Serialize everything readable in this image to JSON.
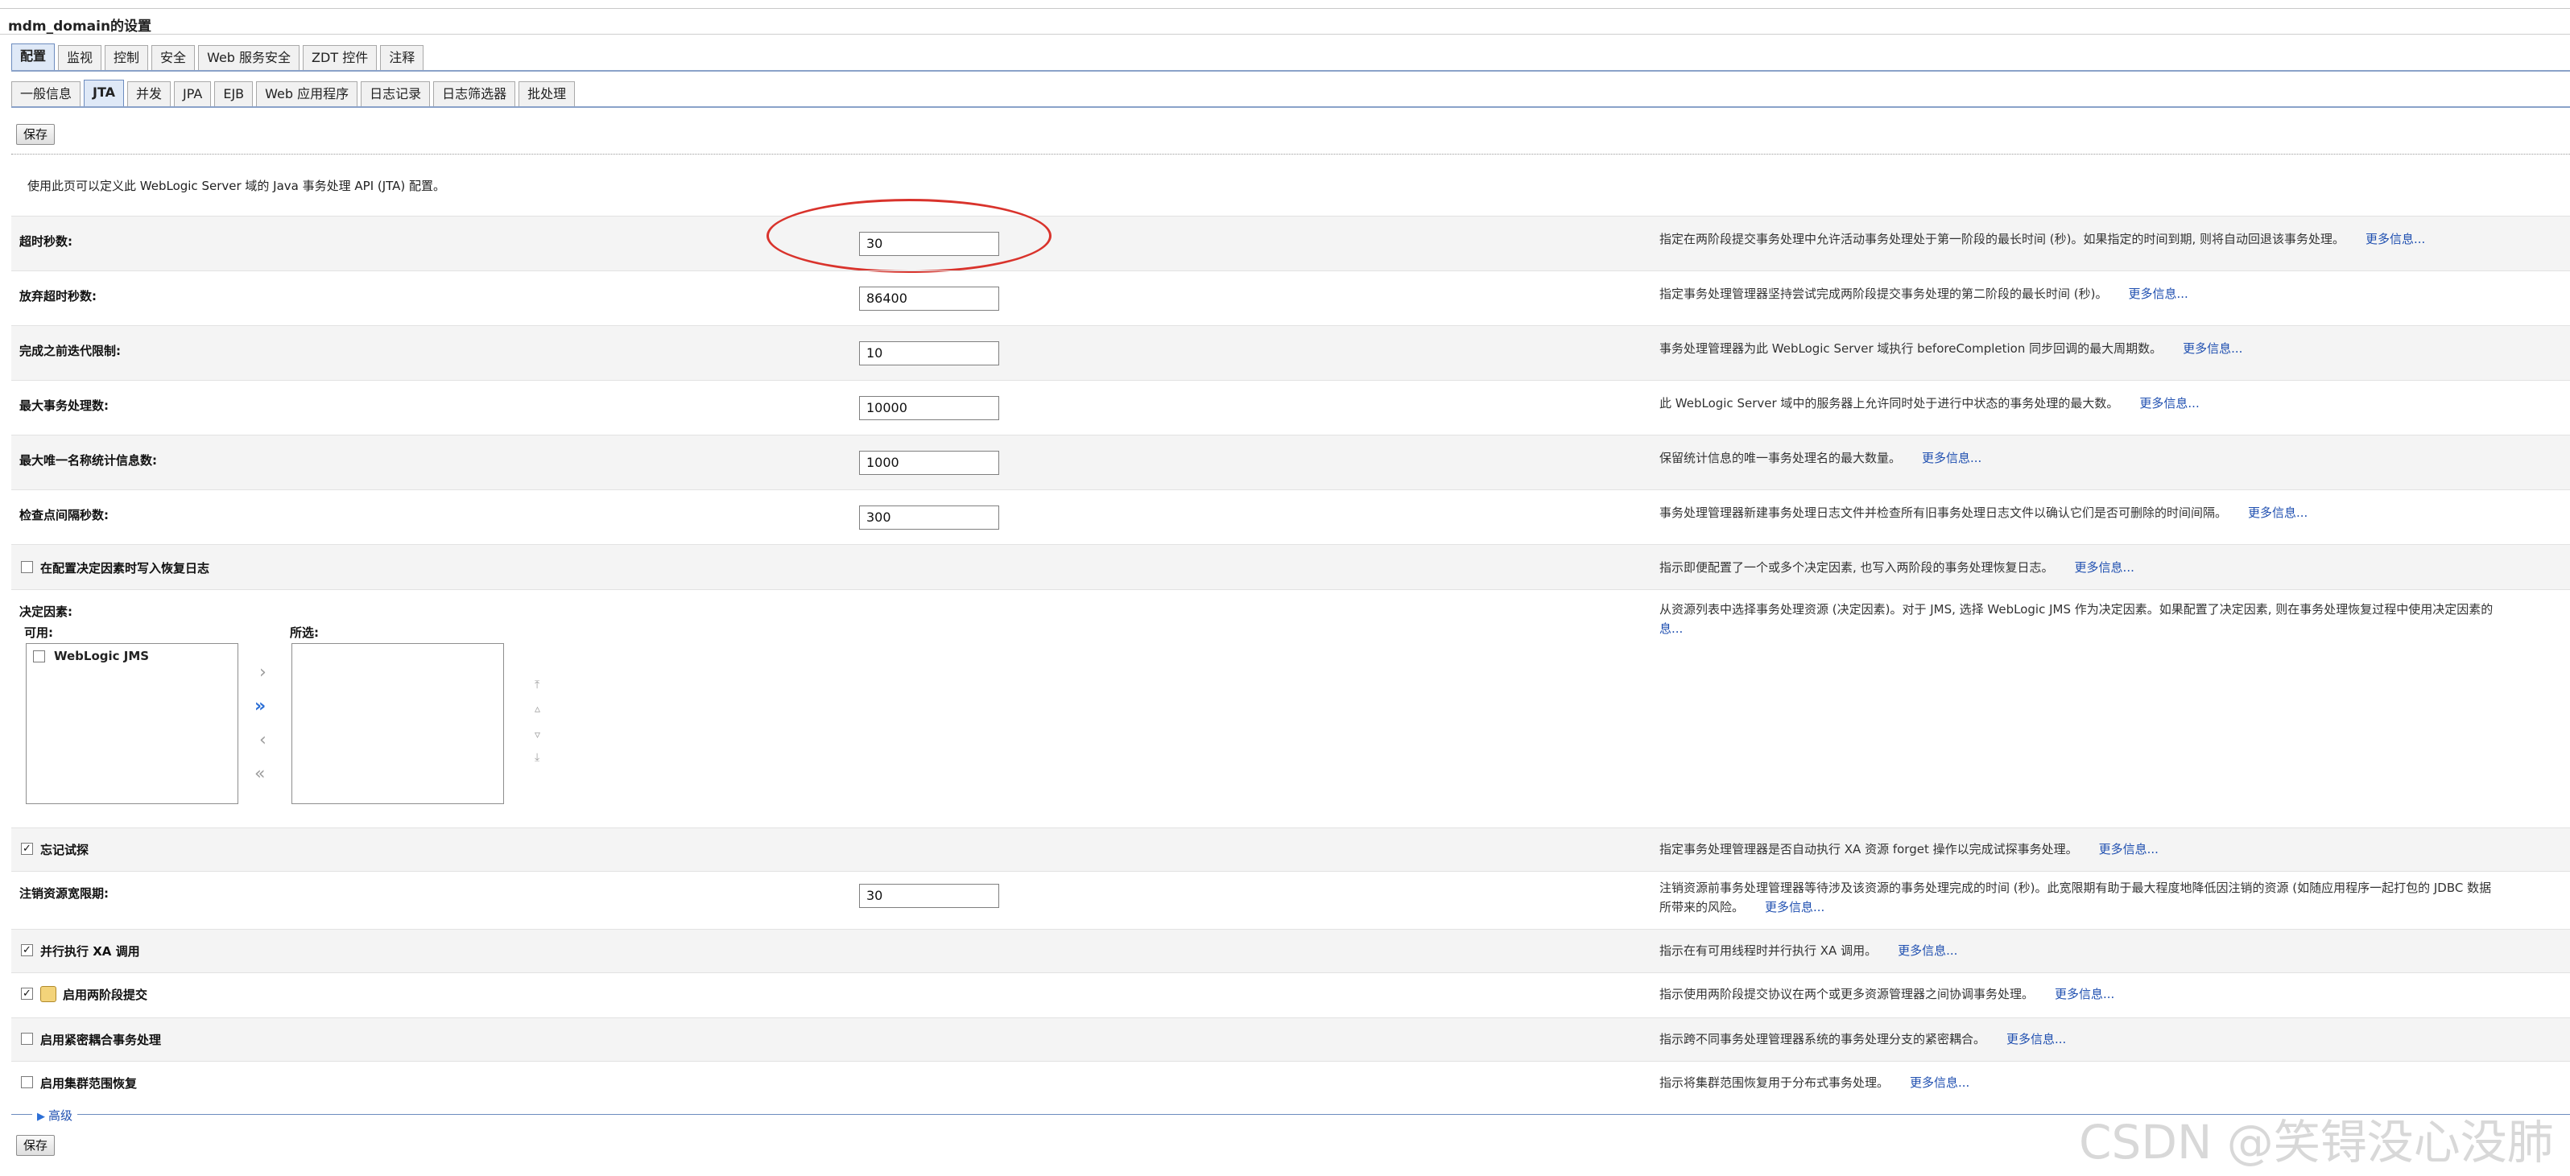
{
  "page_title": "mdm_domain的设置",
  "primary_tabs": [
    "配置",
    "监视",
    "控制",
    "安全",
    "Web 服务安全",
    "ZDT 控件",
    "注释"
  ],
  "secondary_tabs": [
    "一般信息",
    "JTA",
    "并发",
    "JPA",
    "EJB",
    "Web 应用程序",
    "日志记录",
    "日志筛选器",
    "批处理"
  ],
  "save_label": "保存",
  "intro": "使用此页可以定义此 WebLogic Server 域的 Java 事务处理 API (JTA) 配置。",
  "more_label": "更多信息...",
  "fields": {
    "timeout": {
      "label": "超时秒数:",
      "value": "30",
      "desc": "指定在两阶段提交事务处理中允许活动事务处理处于第一阶段的最长时间 (秒)。如果指定的时间到期, 则将自动回退该事务处理。"
    },
    "abandon": {
      "label": "放弃超时秒数:",
      "value": "86400",
      "desc": "指定事务处理管理器坚持尝试完成两阶段提交事务处理的第二阶段的最长时间 (秒)。"
    },
    "before_completion": {
      "label": "完成之前迭代限制:",
      "value": "10",
      "desc": "事务处理管理器为此 WebLogic Server 域执行 beforeCompletion 同步回调的最大周期数。"
    },
    "max_tx": {
      "label": "最大事务处理数:",
      "value": "10000",
      "desc": "此 WebLogic Server 域中的服务器上允许同时处于进行中状态的事务处理的最大数。"
    },
    "max_unique_names": {
      "label": "最大唯一名称统计信息数:",
      "value": "1000",
      "desc": "保留统计信息的唯一事务处理名的最大数量。"
    },
    "checkpoint": {
      "label": "检查点间隔秒数:",
      "value": "300",
      "desc": "事务处理管理器新建事务处理日志文件并检查所有旧事务处理日志文件以确认它们是否可删除的时间间隔。"
    },
    "recovery_log": {
      "label": "在配置决定因素时写入恢复日志",
      "desc": "指示即便配置了一个或多个决定因素, 也写入两阶段的事务处理恢复日志。"
    },
    "determiners": {
      "label": "决定因素:",
      "available": "可用:",
      "chosen": "所选:",
      "option": "WebLogic JMS",
      "desc_line1": "从资源列表中选择事务处理资源 (决定因素)。对于 JMS, 选择 WebLogic JMS 作为决定因素。如果配置了决定因素, 则在事务处理恢复过程中使用决定因素的",
      "desc_line2": "息..."
    },
    "forget": {
      "label": "忘记试探",
      "desc": "指定事务处理管理器是否自动执行 XA 资源 forget 操作以完成试探事务处理。"
    },
    "unregister": {
      "label": "注销资源宽限期:",
      "value": "30",
      "desc_line1": "注销资源前事务处理管理器等待涉及该资源的事务处理完成的时间 (秒)。此宽限期有助于最大程度地降低因注销的资源 (如随应用程序一起打包的 JDBC 数据",
      "desc_line2": "所带来的风险。"
    },
    "parallel_xa": {
      "label": "并行执行 XA 调用",
      "desc": "指示在有可用线程时并行执行 XA 调用。"
    },
    "two_phase": {
      "label": "启用两阶段提交",
      "desc": "指示使用两阶段提交协议在两个或更多资源管理器之间协调事务处理。"
    },
    "tight_coupling": {
      "label": "启用紧密耦合事务处理",
      "desc": "指示跨不同事务处理管理器系统的事务处理分支的紧密耦合。"
    },
    "cluster_recovery": {
      "label": "启用集群范围恢复",
      "desc": "指示将集群范围恢复用于分布式事务处理。"
    }
  },
  "advanced": "高级",
  "watermark": "CSDN @笑锝没心没肺"
}
